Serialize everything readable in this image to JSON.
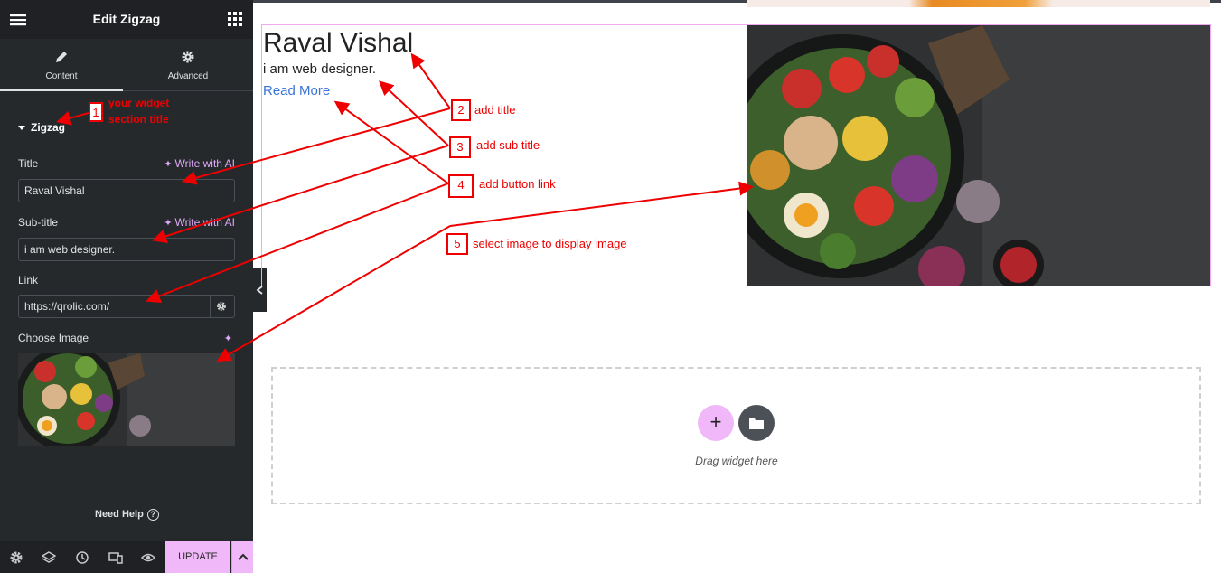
{
  "editor": {
    "title": "Edit Zigzag",
    "tabs": [
      {
        "label": "Content",
        "icon": "pencil-icon",
        "active": true
      },
      {
        "label": "Advanced",
        "icon": "gear-icon",
        "active": false
      }
    ],
    "section_title": "Zigzag",
    "fields": {
      "title_label": "Title",
      "title_value": "Raval Vishal",
      "subtitle_label": "Sub-title",
      "subtitle_value": "i am web designer.",
      "link_label": "Link",
      "link_value": "https://qrolic.com/",
      "image_label": "Choose Image"
    },
    "ai_label": "Write with AI",
    "need_help": "Need Help",
    "update_label": "UPDATE"
  },
  "canvas": {
    "widget_title": "Raval Vishal",
    "widget_subtitle": "i am web designer.",
    "widget_link": "Read More",
    "drag_text": "Drag widget here"
  },
  "annotations": {
    "n1": "1",
    "t1_line1": "your widget",
    "t1_line2": "section title",
    "n2": "2",
    "t2": "add title",
    "n3": "3",
    "t3": "add sub title",
    "n4": "4",
    "t4": "add button link",
    "n5": "5",
    "t5": "select image to display image"
  },
  "colors": {
    "sidebar_bg": "#26292c",
    "accent_pink": "#f0b8f8",
    "ai_purple": "#e0a8f8",
    "link_blue": "#3b74d8",
    "annotation_red": "#e00000"
  }
}
